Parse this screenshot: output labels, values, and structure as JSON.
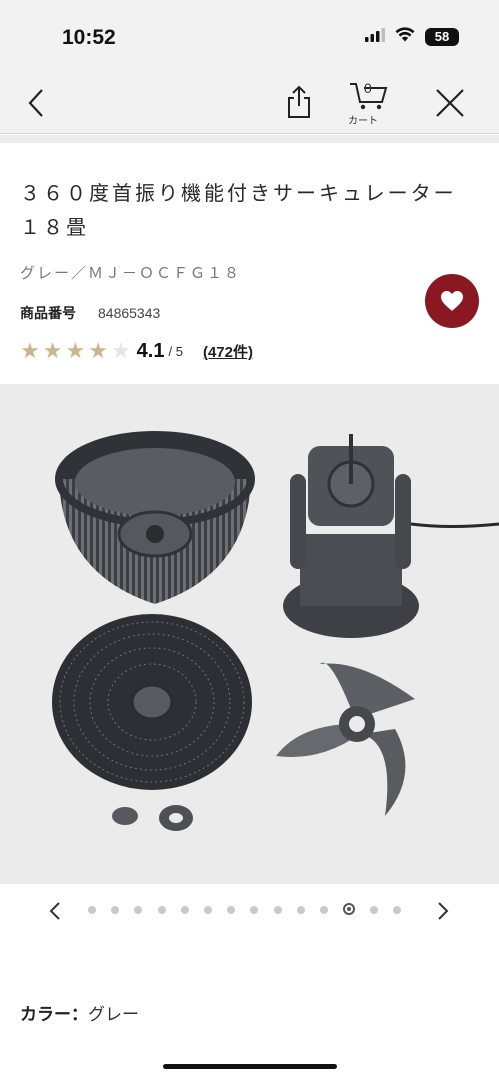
{
  "status": {
    "time": "10:52",
    "battery": "58",
    "icons": [
      "signal-icon",
      "wifi-icon",
      "battery-icon"
    ]
  },
  "nav": {
    "back_icon": "chevron-left-icon",
    "share_icon": "share-icon",
    "cart_icon": "cart-icon",
    "cart_count": "0",
    "cart_label": "カート",
    "close_icon": "close-icon"
  },
  "product": {
    "title": "３６０度首振り機能付きサーキュレーター　１８畳",
    "variant": "グレー／ＭＪ－ＯＣＦＧ１８",
    "sku_label": "商品番号",
    "sku_value": "84865343",
    "favorite_color": "#8a1822",
    "rating": {
      "stars_filled": 4,
      "stars_total": 5,
      "value": "4.1",
      "max": "/ 5",
      "review_count": "(472件)"
    }
  },
  "carousel": {
    "total": 14,
    "active_index": 11,
    "prev_icon": "chevron-left-icon",
    "next_icon": "chevron-right-icon"
  },
  "color": {
    "label": "カラー：",
    "value": "グレー"
  },
  "colors": {
    "accent": "#8a1822",
    "star": "#c9b68c",
    "bar_bg": "#f2f2f2"
  }
}
